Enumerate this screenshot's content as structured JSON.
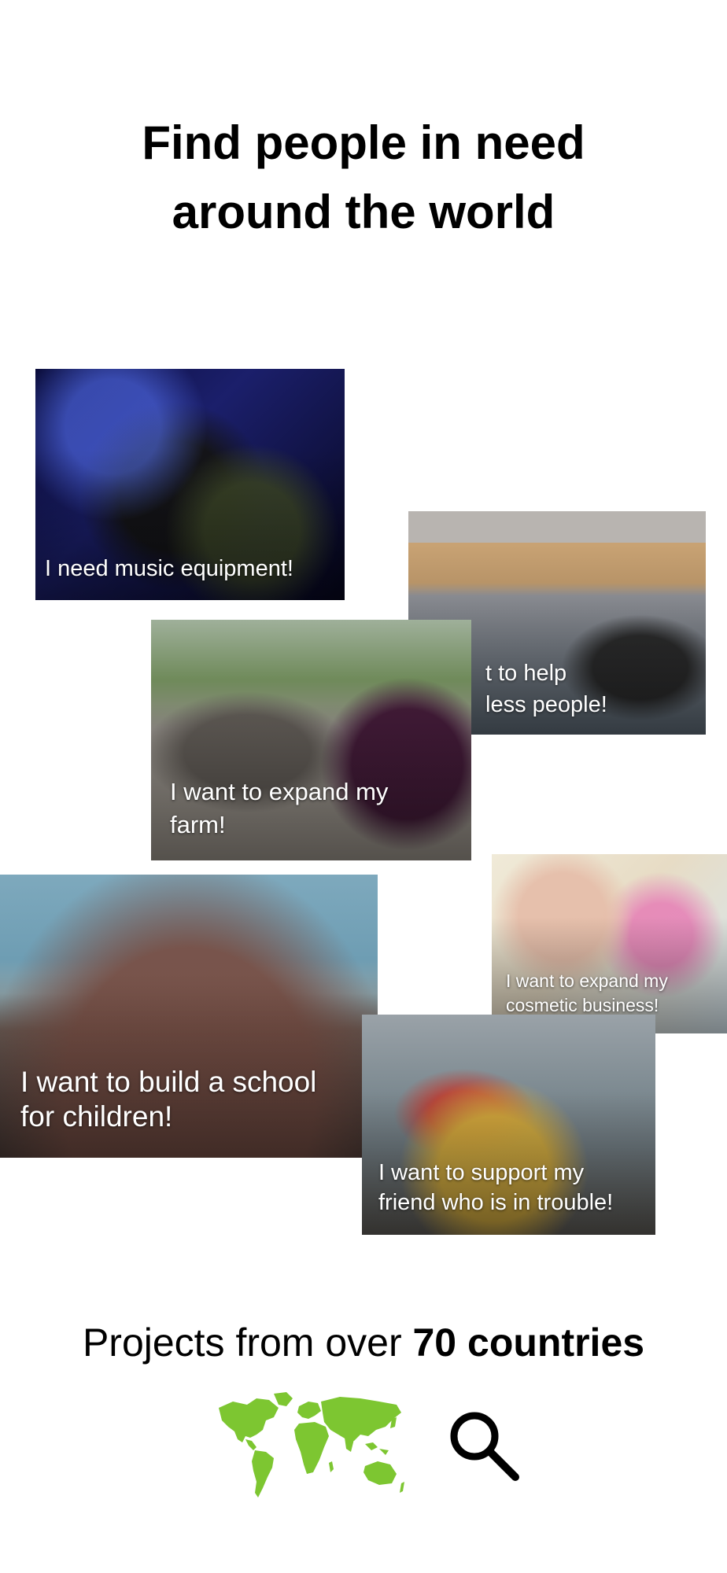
{
  "headline": {
    "line1": "Find people in need",
    "line2": "around the world"
  },
  "projects": [
    {
      "id": "music",
      "caption": "I need music equipment!"
    },
    {
      "id": "homeless",
      "caption_line1": "t to help",
      "caption_line2": "less people!"
    },
    {
      "id": "farm",
      "caption_line1": "I want to expand my",
      "caption_line2": "farm!"
    },
    {
      "id": "cosmetic",
      "caption_line1": "I want to expand my",
      "caption_line2": "cosmetic business!"
    },
    {
      "id": "school",
      "caption_line1": "I want to build a school",
      "caption_line2": "for children!"
    },
    {
      "id": "friend",
      "caption_line1": "I want to support my",
      "caption_line2": "friend who is in trouble!"
    }
  ],
  "countries": {
    "prefix": "Projects from over ",
    "bold": "70 countries"
  },
  "icons": {
    "map": "world-map-icon",
    "search": "search-icon"
  },
  "colors": {
    "map_green": "#7dc631",
    "text": "#000000",
    "caption": "#ffffff"
  }
}
